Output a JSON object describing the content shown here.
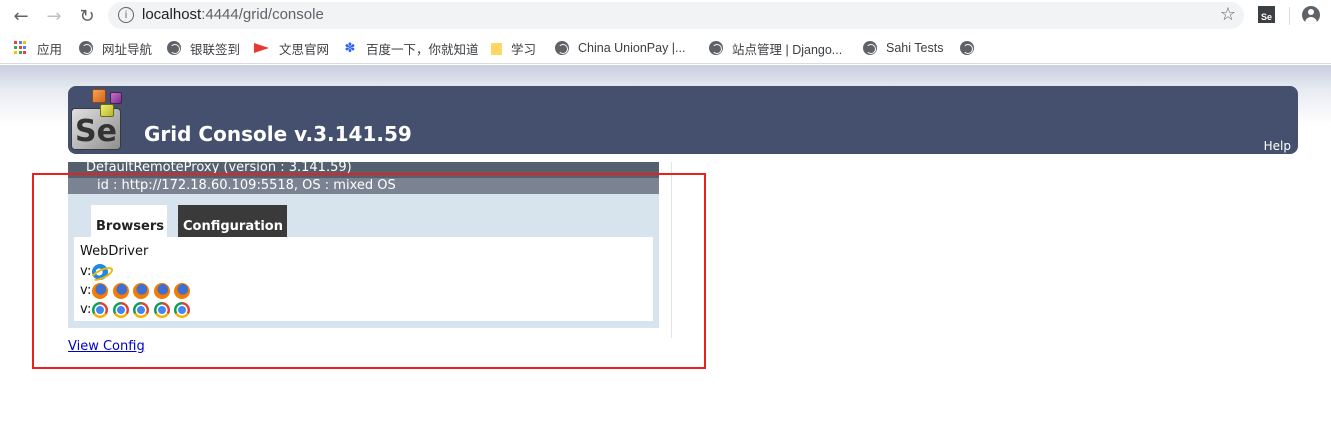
{
  "browser": {
    "url_host": "localhost",
    "url_rest": ":4444/grid/console",
    "extension_label": "Se",
    "bookmarks": [
      {
        "label": "应用",
        "icon": "apps-grid-icon"
      },
      {
        "label": "网址导航",
        "icon": "globe-icon"
      },
      {
        "label": "银联签到",
        "icon": "globe-icon"
      },
      {
        "label": "文思官网",
        "icon": "flag-icon"
      },
      {
        "label": "百度一下，你就知道",
        "icon": "baidu-paw-icon"
      },
      {
        "label": "学习",
        "icon": "folder-icon"
      },
      {
        "label": "China UnionPay |...",
        "icon": "globe-icon"
      },
      {
        "label": "站点管理 | Django...",
        "icon": "globe-icon"
      },
      {
        "label": "Sahi Tests",
        "icon": "globe-icon"
      },
      {
        "label": "",
        "icon": "globe-icon"
      }
    ]
  },
  "header": {
    "logo_text": "Se",
    "title": "Grid Console v.3.141.59",
    "help": "Help"
  },
  "proxy": {
    "name_line": "DefaultRemoteProxy (version : 3.141.59)",
    "id_line": "id : http://172.18.60.109:5518, OS : mixed OS",
    "tabs": {
      "browsers": "Browsers",
      "configuration": "Configuration"
    },
    "protocol": "WebDriver",
    "version_prefix": "v:",
    "browser_rows": [
      {
        "browser": "internet explorer",
        "count": 1
      },
      {
        "browser": "firefox",
        "count": 5
      },
      {
        "browser": "chrome",
        "count": 5
      }
    ]
  },
  "view_config": "View Config",
  "colors": {
    "header_bg": "#44506e",
    "highlight_border": "#e8211d",
    "proxy_body_bg": "#d7e4ee"
  }
}
